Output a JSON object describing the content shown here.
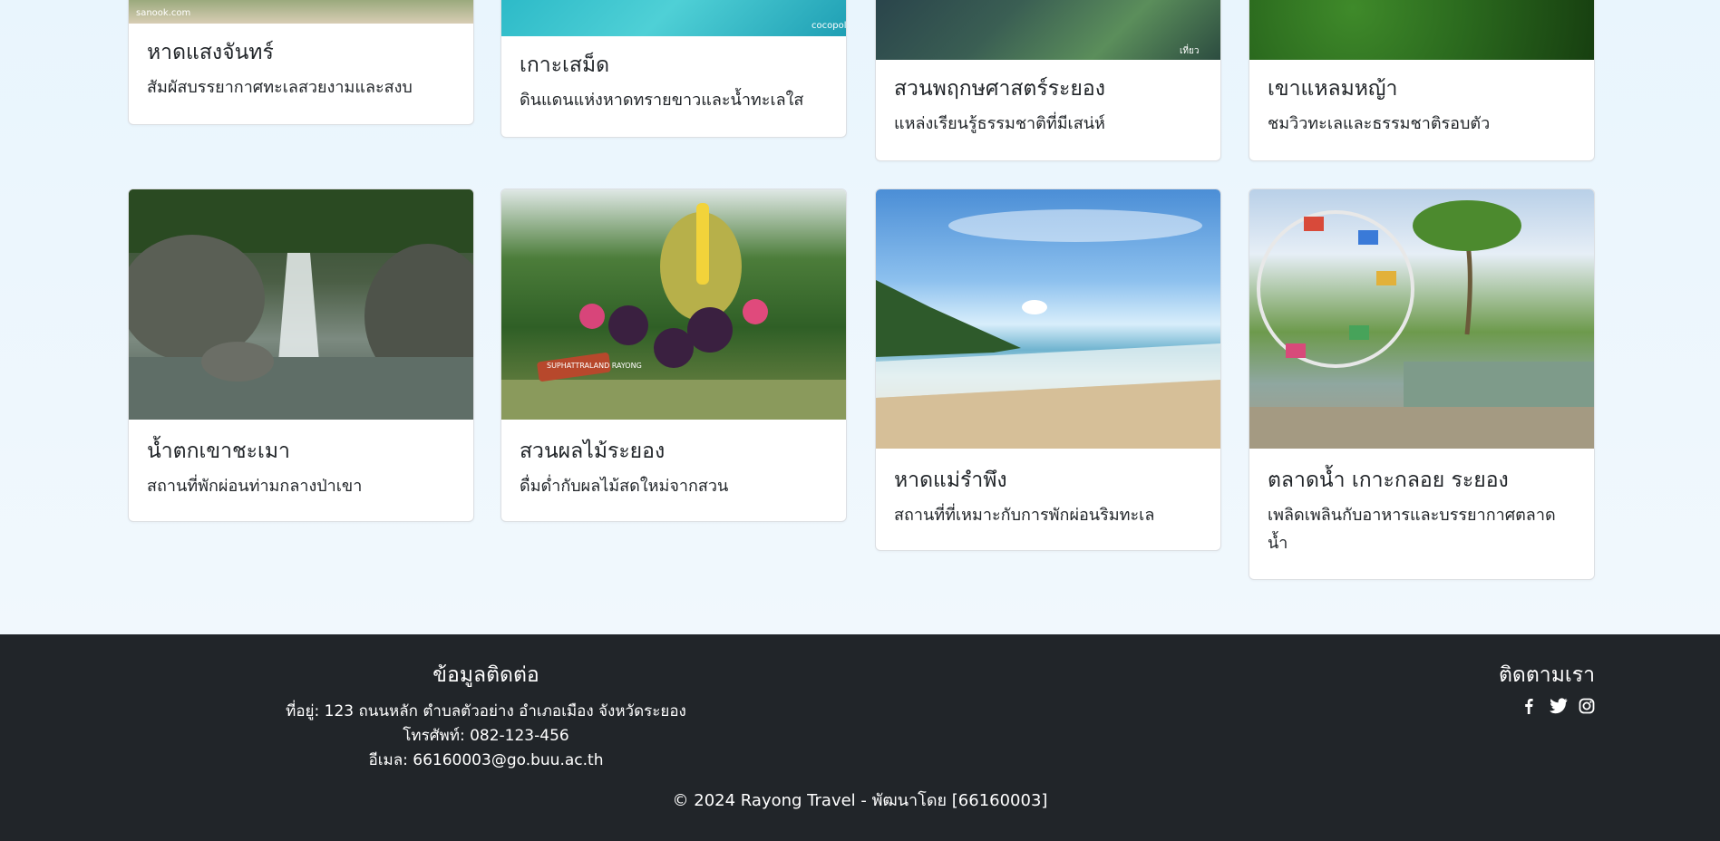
{
  "cards_row1": [
    {
      "title": "หาดแสงจันทร์",
      "desc": "สัมผัสบรรยากาศทะเลสวยงามและสงบ",
      "photo_tag": "sanook.com"
    },
    {
      "title": "เกาะเสม็ด",
      "desc": "ดินแดนแห่งหาดทรายขาวและน้ำทะเลใส",
      "photo_tag": "cocopoll"
    },
    {
      "title": "สวนพฤกษศาสตร์ระยอง",
      "desc": "แหล่งเรียนรู้ธรรมชาติที่มีเสน่ห์",
      "photo_tag": "เที่ยวระยอง"
    },
    {
      "title": "เขาแหลมหญ้า",
      "desc": "ชมวิวทะเลและธรรมชาติรอบตัว",
      "photo_tag": ""
    }
  ],
  "cards_row2": [
    {
      "title": "น้ำตกเขาชะเมา",
      "desc": "สถานที่พักผ่อนท่ามกลางป่าเขา"
    },
    {
      "title": "สวนผลไม้ระยอง",
      "desc": "ดื่มด่ำกับผลไม้สดใหม่จากสวน",
      "photo_sign": "SUPHATTRALAND RAYONG"
    },
    {
      "title": "หาดแม่รำพึง",
      "desc": "สถานที่ที่เหมาะกับการพักผ่อนริมทะเล"
    },
    {
      "title": "ตลาดน้ำ เกาะกลอย ระยอง",
      "desc": "เพลิดเพลินกับอาหารและบรรยากาศตลาดน้ำ"
    }
  ],
  "footer": {
    "contact_title": "ข้อมูลติดต่อ",
    "address": "ที่อยู่: 123 ถนนหลัก ตำบลตัวอย่าง อำเภอเมือง จังหวัดระยอง",
    "phone": "โทรศัพท์: 082-123-456",
    "email": "อีเมล: 66160003@go.buu.ac.th",
    "follow_title": "ติดตามเรา",
    "social": [
      "facebook-icon",
      "twitter-icon",
      "instagram-icon"
    ],
    "copyright": "© 2024 Rayong Travel - พัฒนาโดย [66160003]"
  },
  "colors": {
    "footer_bg": "#212529",
    "page_bg": "#eef6fc",
    "text": "#212529"
  }
}
